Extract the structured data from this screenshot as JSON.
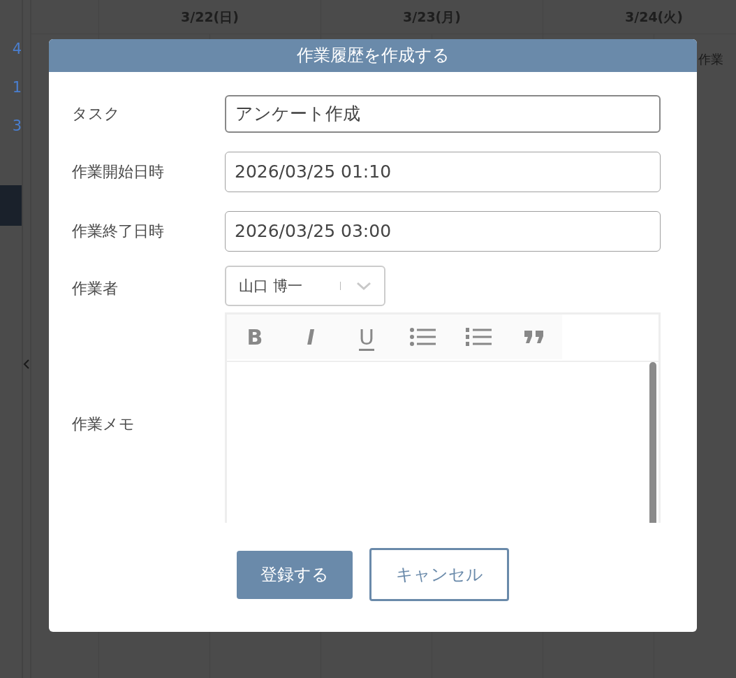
{
  "background": {
    "left_numbers": [
      "4",
      "1",
      "3"
    ],
    "day_headers": [
      "3/22(日)",
      "3/23(月)",
      "3/24(火)"
    ],
    "event_label": "作業"
  },
  "dialog": {
    "title": "作業履歴を作成する",
    "fields": [
      {
        "label": "タスク",
        "kind": "text",
        "value": "アンケート作成",
        "focused": true
      },
      {
        "label": "作業開始日時",
        "kind": "text",
        "value": "2026/03/25 01:10",
        "focused": false
      },
      {
        "label": "作業終了日時",
        "kind": "text",
        "value": "2026/03/25 03:00",
        "focused": false
      },
      {
        "label": "作業者",
        "kind": "select",
        "value": "山口 博一"
      },
      {
        "label": "作業メモ",
        "kind": "editor"
      }
    ],
    "toolbar": [
      {
        "kind": "bold",
        "label": "B"
      },
      {
        "kind": "italic",
        "label": "I"
      },
      {
        "kind": "underline",
        "label": "U"
      },
      {
        "kind": "bullet-list"
      },
      {
        "kind": "ordered-list"
      },
      {
        "kind": "quote"
      }
    ],
    "buttons": [
      {
        "label": "登録する",
        "kind": "primary"
      },
      {
        "label": "キャンセル",
        "kind": "secondary"
      }
    ]
  }
}
